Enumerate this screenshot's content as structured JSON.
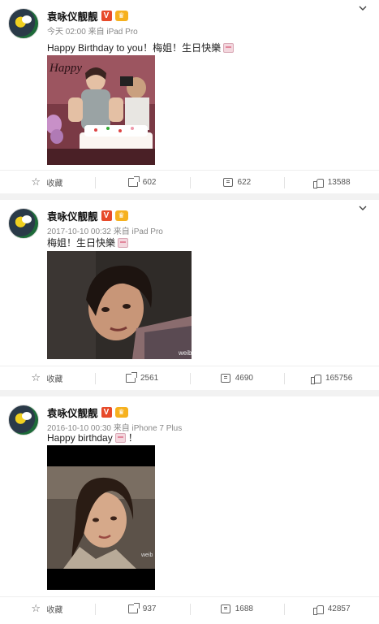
{
  "user": {
    "name": "袁咏仪靓靓",
    "verified_mark": "V",
    "vip_mark": "♛"
  },
  "posts": [
    {
      "meta": "今天 02:00 来自 iPad Pro",
      "text": "Happy Birthday to you！梅姐！生日快樂",
      "image_caption": "Happy",
      "actions": {
        "favorite": "收藏",
        "repost": "602",
        "comment": "622",
        "like": "13588"
      }
    },
    {
      "meta": "2017-10-10 00:32 来自 iPad Pro",
      "text": "梅姐！生日快樂",
      "image_watermark": "weibo",
      "actions": {
        "favorite": "收藏",
        "repost": "2561",
        "comment": "4690",
        "like": "165756"
      }
    },
    {
      "meta": "2016-10-10 00:30 来自 iPhone 7 Plus",
      "text": "Happy birthday",
      "text_suffix": "！",
      "image_watermark": "weib",
      "actions": {
        "favorite": "收藏",
        "repost": "937",
        "comment": "1688",
        "like": "42857"
      }
    }
  ],
  "icons": {
    "more": "chevron-down-icon",
    "favorite": "star-icon",
    "repost": "share-icon",
    "comment": "comment-icon",
    "like": "thumbs-up-icon",
    "emoji": "cake-emoji-icon"
  }
}
